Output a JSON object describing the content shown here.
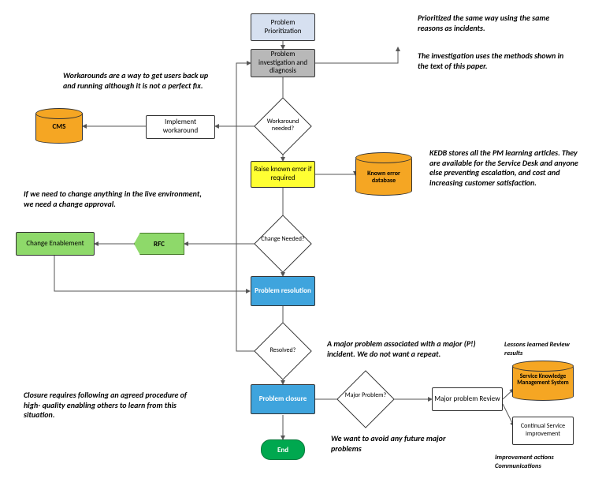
{
  "nodes": {
    "prioritization": "Problem Prioritization",
    "investigation": "Problem investigation and diagnosis",
    "workaround_q": "Workaround needed?",
    "impl_workaround": "Implement workaround",
    "cms": "CMS",
    "raise_known": "Raise known error if required",
    "kedb": "Known error database",
    "change_q": "Change Needed?",
    "rfc": "RFC",
    "change_enablement": "Change Enablement",
    "resolution": "Problem resolution",
    "resolved_q": "Resolved?",
    "closure": "Problem closure",
    "major_q": "Major Problem?",
    "major_review": "Major problem Review",
    "skms": "Service Knowledge Management System",
    "csi": "Continual Service improvement",
    "end": "End"
  },
  "annotations": {
    "a1": "Prioritized the same way using the same reasons as incidents.",
    "a2": "The investigation uses the methods shown in the text of this paper.",
    "a3": "Workarounds are a way to get users back up and running although it is not a perfect fix.",
    "a4": "KEDB stores all the PM learning articles. They are available for the Service Desk and anyone else preventing escalation, and cost and increasing customer satisfaction.",
    "a5": "If we need to change anything in the live environment, we need a change approval.",
    "a6": "A major problem associated with a major (P!) incident. We do not want a repeat.",
    "a7": "Closure requires following an agreed procedure of high- quality enabling others to learn from this situation.",
    "a8": "We want to avoid any future major problems",
    "a9": "Lessons learned Review results",
    "a10": "Improvement actions Communications"
  }
}
